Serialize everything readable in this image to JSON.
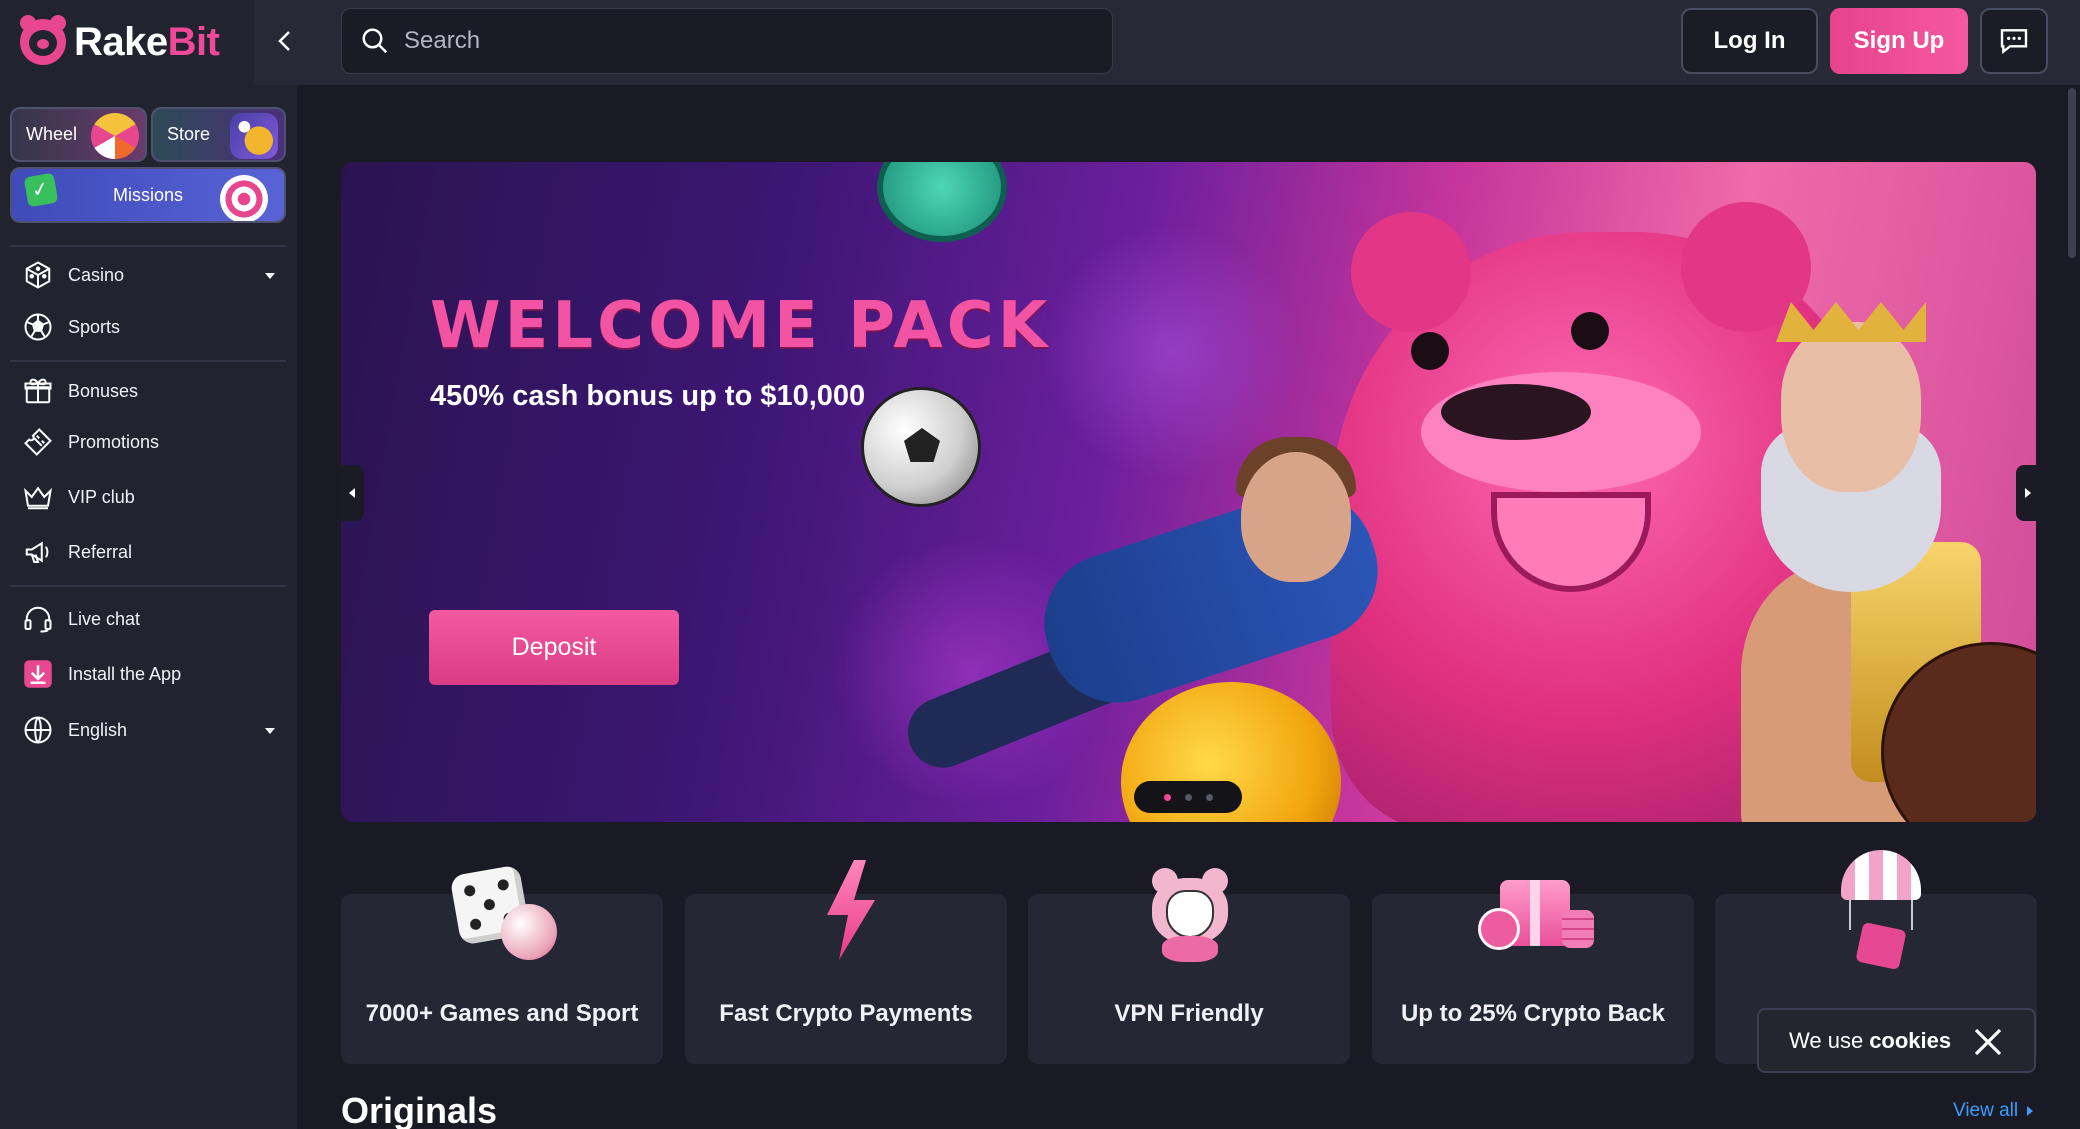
{
  "brand": {
    "name_part1": "Rake",
    "name_part2": "Bit"
  },
  "quick_links": {
    "wheel": "Wheel",
    "store": "Store",
    "missions": "Missions"
  },
  "sidebar": {
    "casino": "Casino",
    "sports": "Sports",
    "bonuses": "Bonuses",
    "promotions": "Promotions",
    "vip": "VIP club",
    "referral": "Referral",
    "live_chat": "Live chat",
    "install": "Install the App",
    "language": "English"
  },
  "header": {
    "search_placeholder": "Search",
    "login": "Log In",
    "signup": "Sign Up"
  },
  "banner": {
    "title": "WELCOME PACK",
    "subtitle": "450% cash bonus up to $10,000",
    "cta": "Deposit",
    "slide_count": 3,
    "active_slide": 1
  },
  "features": [
    {
      "label": "7000+ Games and Sport",
      "icon": "dice-icon"
    },
    {
      "label": "Fast Crypto Payments",
      "icon": "lightning-icon"
    },
    {
      "label": "VPN Friendly",
      "icon": "masked-bear-icon"
    },
    {
      "label": "Up to 25% Crypto Back",
      "icon": "gift-coins-icon"
    },
    {
      "label": "",
      "icon": "parachute-gift-icon"
    }
  ],
  "sections": {
    "originals": "Originals",
    "view_all": "View all"
  },
  "cookie_banner": {
    "text": "We use",
    "bold": "cookies"
  },
  "colors": {
    "accent": "#f1499a",
    "background": "#191a23",
    "sidebar": "#21232e",
    "link": "#3b9cff"
  }
}
